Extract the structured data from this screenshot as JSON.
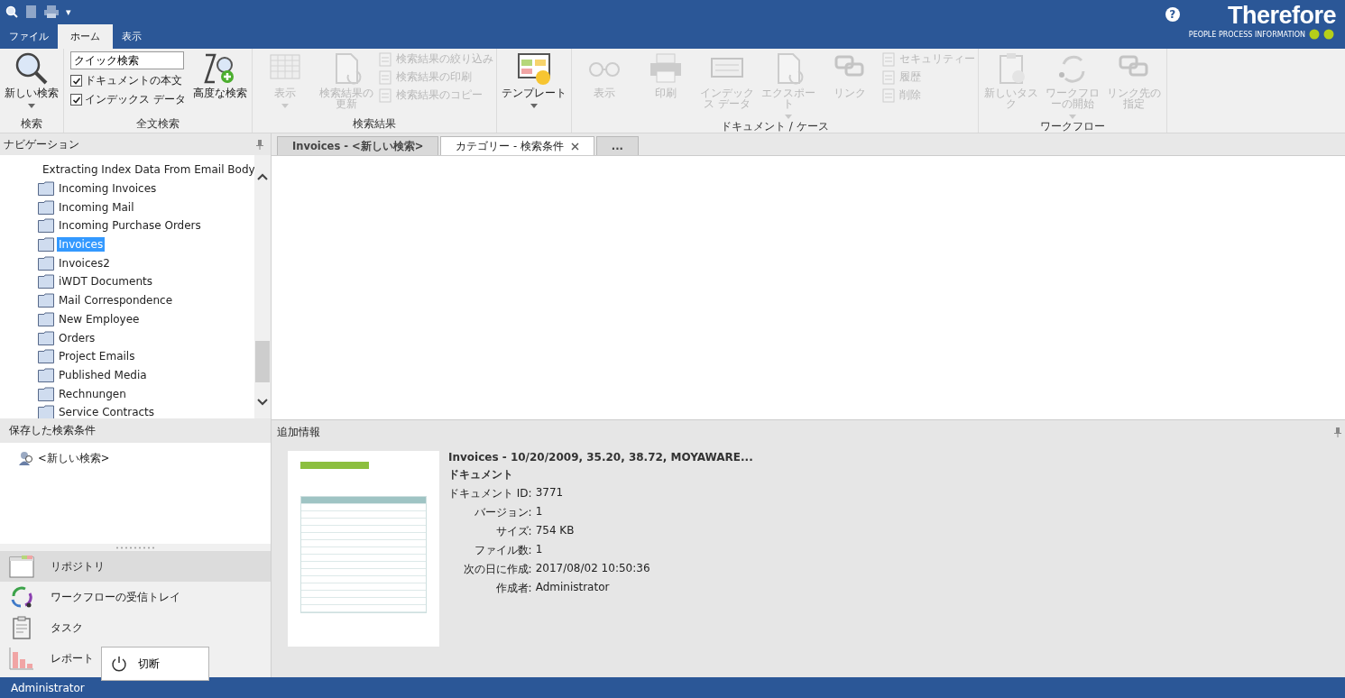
{
  "quick_access": {
    "dropdown": "▾"
  },
  "help": {
    "label": "?"
  },
  "logo": {
    "text": "Therefore",
    "tagline": "PEOPLE  PROCESS  INFORMATION"
  },
  "ribbon_tabs": [
    {
      "label": "ファイル",
      "selected": false
    },
    {
      "label": "ホーム",
      "selected": true
    },
    {
      "label": "表示",
      "selected": false
    }
  ],
  "ribbon": {
    "groups": [
      {
        "label": "検索",
        "items": [
          {
            "kind": "large",
            "label": "新しい検索",
            "disabled": false,
            "dropdown": true
          }
        ]
      },
      {
        "label": "全文検索",
        "search_field": {
          "value": "クイック検索"
        },
        "checkboxes": [
          {
            "label": "ドキュメントの本文",
            "checked": true
          },
          {
            "label": "インデックス データ",
            "checked": true
          }
        ],
        "items": [
          {
            "kind": "large",
            "label": "高度な検索",
            "disabled": false,
            "dropdown": false
          }
        ]
      },
      {
        "label": "検索結果",
        "items": [
          {
            "kind": "large",
            "label": "表示",
            "disabled": true,
            "dropdown": true
          },
          {
            "kind": "large",
            "label": "検索結果の更新",
            "disabled": true,
            "dropdown": false
          },
          {
            "kind": "small",
            "label": "検索結果の絞り込み",
            "disabled": true
          },
          {
            "kind": "small",
            "label": "検索結果の印刷",
            "disabled": true
          },
          {
            "kind": "small",
            "label": "検索結果のコピー",
            "disabled": true
          }
        ]
      },
      {
        "items": [
          {
            "kind": "large",
            "label": "テンプレート",
            "disabled": false,
            "dropdown": true
          }
        ]
      },
      {
        "label": "ドキュメント / ケース",
        "items": [
          {
            "kind": "large",
            "label": "表示",
            "disabled": true,
            "dropdown": false
          },
          {
            "kind": "large",
            "label": "印刷",
            "disabled": true,
            "dropdown": false
          },
          {
            "kind": "large",
            "label": "インデックス データ",
            "disabled": true,
            "dropdown": false
          },
          {
            "kind": "large",
            "label": "エクスポート",
            "disabled": true,
            "dropdown": true
          },
          {
            "kind": "large",
            "label": "リンク",
            "disabled": true,
            "dropdown": false
          },
          {
            "kind": "small",
            "label": "セキュリティー",
            "disabled": true
          },
          {
            "kind": "small",
            "label": "履歴",
            "disabled": true
          },
          {
            "kind": "small",
            "label": "削除",
            "disabled": true
          }
        ]
      },
      {
        "label": "ワークフロー",
        "items": [
          {
            "kind": "large",
            "label": "新しいタスク",
            "disabled": true,
            "dropdown": false
          },
          {
            "kind": "large",
            "label": "ワークフローの開始",
            "disabled": true,
            "dropdown": true
          },
          {
            "kind": "large",
            "label": "リンク先の指定",
            "disabled": true,
            "dropdown": false
          }
        ]
      }
    ]
  },
  "navigation": {
    "title": "ナビゲーション",
    "items": [
      {
        "label": "Extracting Index Data From Email Body",
        "selected": false
      },
      {
        "label": "Incoming Invoices",
        "selected": false
      },
      {
        "label": "Incoming Mail",
        "selected": false
      },
      {
        "label": "Incoming Purchase Orders",
        "selected": false
      },
      {
        "label": "Invoices",
        "selected": true
      },
      {
        "label": "Invoices2",
        "selected": false
      },
      {
        "label": "iWDT Documents",
        "selected": false
      },
      {
        "label": "Mail Correspondence",
        "selected": false
      },
      {
        "label": "New Employee",
        "selected": false
      },
      {
        "label": "Orders",
        "selected": false
      },
      {
        "label": "Project Emails",
        "selected": false
      },
      {
        "label": "Published Media",
        "selected": false
      },
      {
        "label": "Rechnungen",
        "selected": false
      },
      {
        "label": "Service Contracts",
        "selected": false
      }
    ]
  },
  "saved_searches": {
    "title": "保存した検索条件",
    "items": [
      "<新しい検索>"
    ]
  },
  "nav_buttons": [
    {
      "label": "リポジトリ",
      "selected": true
    },
    {
      "label": "ワークフローの受信トレイ",
      "selected": false
    },
    {
      "label": "タスク",
      "selected": false
    },
    {
      "label": "レポート",
      "selected": false
    }
  ],
  "document_tabs": [
    {
      "label": "Invoices - <新しい検索>",
      "selected": false,
      "closable": false
    },
    {
      "label": "カテゴリー - 検索条件",
      "selected": true,
      "closable": true
    },
    {
      "label": "...",
      "selected": false,
      "closable": false
    }
  ],
  "details": {
    "title": "追加情報",
    "document_title": "Invoices - 10/20/2009, 35.20, 38.72, MOYAWARE...",
    "type": "ドキュメント",
    "fields": [
      {
        "label": "ドキュメント ID:",
        "value": "3771"
      },
      {
        "label": "バージョン:",
        "value": "1"
      },
      {
        "label": "サイズ:",
        "value": "754 KB"
      },
      {
        "label": "ファイル数:",
        "value": "1"
      },
      {
        "label": "次の日に作成:",
        "value": "2017/08/02 10:50:36"
      },
      {
        "label": "作成者:",
        "value": "Administrator"
      }
    ]
  },
  "popup_menu": {
    "items": [
      {
        "label": "切断"
      }
    ]
  },
  "status_bar": {
    "user": "Administrator"
  }
}
